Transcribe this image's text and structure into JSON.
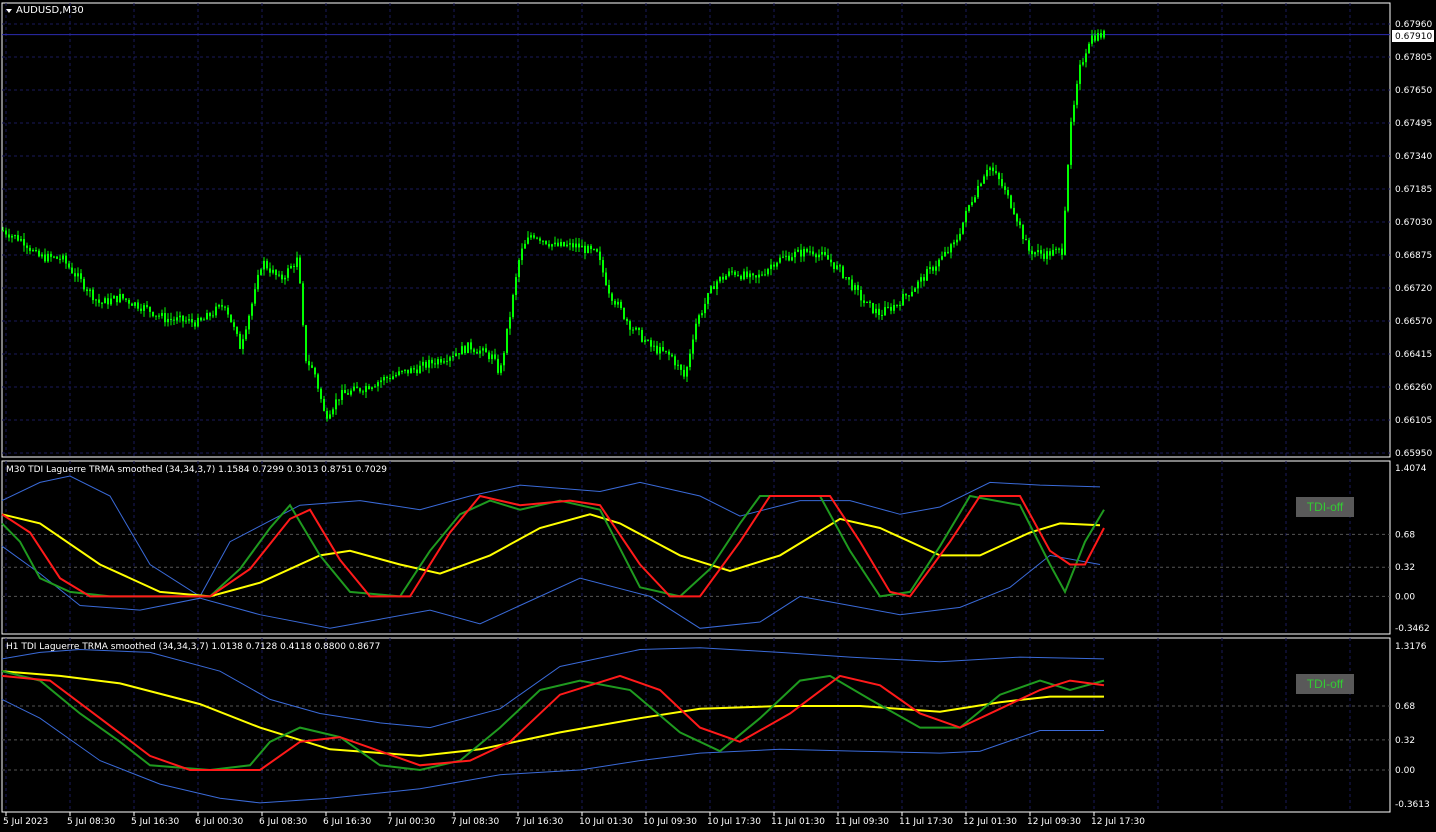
{
  "window": {
    "title": "AUDUSD,M30",
    "current_price": "0.67910"
  },
  "colors": {
    "background": "#000000",
    "grid": "#1a1a5a",
    "candle": "#00ff00",
    "price_line": "#2b2bb0",
    "tdi_green": "#1f9a1f",
    "tdi_red": "#ff1a1a",
    "tdi_yellow": "#ffff00",
    "tdi_band": "#3a6ad8"
  },
  "price_panel": {
    "y_ticks": [
      "0.67960",
      "0.67805",
      "0.67650",
      "0.67495",
      "0.67340",
      "0.67185",
      "0.67030",
      "0.66875",
      "0.66720",
      "0.66570",
      "0.66415",
      "0.66260",
      "0.66105",
      "0.65950"
    ]
  },
  "indicator_m30": {
    "label": "M30 TDI Laguerre TRMA smoothed (34,34,3,7) 1.1584 0.7299 0.3013 0.8751 0.7029",
    "y_ticks": [
      "1.4074",
      "0.68",
      "0.32",
      "0.00",
      "-0.3462"
    ],
    "button_label": "TDI-off"
  },
  "indicator_h1": {
    "label": "H1 TDI Laguerre TRMA smoothed (34,34,3,7) 1.0138 0.7128 0.4118 0.8800 0.8677",
    "y_ticks": [
      "1.3176",
      "0.68",
      "0.32",
      "0.00",
      "-0.3613"
    ],
    "button_label": "TDI-off"
  },
  "time_axis": {
    "labels": [
      "5 Jul 2023",
      "5 Jul 08:30",
      "5 Jul 16:30",
      "6 Jul 00:30",
      "6 Jul 08:30",
      "6 Jul 16:30",
      "7 Jul 00:30",
      "7 Jul 08:30",
      "7 Jul 16:30",
      "10 Jul 01:30",
      "10 Jul 09:30",
      "10 Jul 17:30",
      "11 Jul 01:30",
      "11 Jul 09:30",
      "11 Jul 17:30",
      "12 Jul 01:30",
      "12 Jul 09:30",
      "12 Jul 17:30"
    ]
  },
  "chart_data": {
    "type": "candlestick",
    "symbol": "AUDUSD",
    "timeframe": "M30",
    "ylim": [
      0.6595,
      0.6796
    ],
    "close_path": [
      [
        0,
        0.67
      ],
      [
        25,
        0.6694
      ],
      [
        37,
        0.6687
      ],
      [
        62,
        0.6686
      ],
      [
        80,
        0.6676
      ],
      [
        100,
        0.6665
      ],
      [
        120,
        0.6668
      ],
      [
        145,
        0.6663
      ],
      [
        165,
        0.6658
      ],
      [
        200,
        0.6656
      ],
      [
        225,
        0.6665
      ],
      [
        240,
        0.6645
      ],
      [
        255,
        0.667
      ],
      [
        262,
        0.6685
      ],
      [
        280,
        0.6676
      ],
      [
        298,
        0.6686
      ],
      [
        305,
        0.664
      ],
      [
        315,
        0.6632
      ],
      [
        325,
        0.6612
      ],
      [
        340,
        0.6622
      ],
      [
        360,
        0.6625
      ],
      [
        385,
        0.663
      ],
      [
        420,
        0.6635
      ],
      [
        445,
        0.664
      ],
      [
        470,
        0.6645
      ],
      [
        492,
        0.664
      ],
      [
        500,
        0.6632
      ],
      [
        512,
        0.6665
      ],
      [
        520,
        0.6688
      ],
      [
        532,
        0.6698
      ],
      [
        555,
        0.6692
      ],
      [
        578,
        0.6692
      ],
      [
        597,
        0.6688
      ],
      [
        610,
        0.667
      ],
      [
        630,
        0.6655
      ],
      [
        650,
        0.6645
      ],
      [
        672,
        0.664
      ],
      [
        685,
        0.663
      ],
      [
        695,
        0.6655
      ],
      [
        715,
        0.6675
      ],
      [
        733,
        0.668
      ],
      [
        755,
        0.6676
      ],
      [
        775,
        0.6685
      ],
      [
        793,
        0.6688
      ],
      [
        812,
        0.669
      ],
      [
        830,
        0.6685
      ],
      [
        845,
        0.6678
      ],
      [
        865,
        0.6665
      ],
      [
        880,
        0.666
      ],
      [
        897,
        0.6665
      ],
      [
        915,
        0.6673
      ],
      [
        935,
        0.6683
      ],
      [
        955,
        0.6693
      ],
      [
        970,
        0.6712
      ],
      [
        988,
        0.673
      ],
      [
        1000,
        0.6722
      ],
      [
        1015,
        0.6708
      ],
      [
        1028,
        0.669
      ],
      [
        1045,
        0.6688
      ],
      [
        1062,
        0.669
      ],
      [
        1070,
        0.6745
      ],
      [
        1080,
        0.6775
      ],
      [
        1090,
        0.679
      ],
      [
        1105,
        0.6791
      ]
    ]
  }
}
